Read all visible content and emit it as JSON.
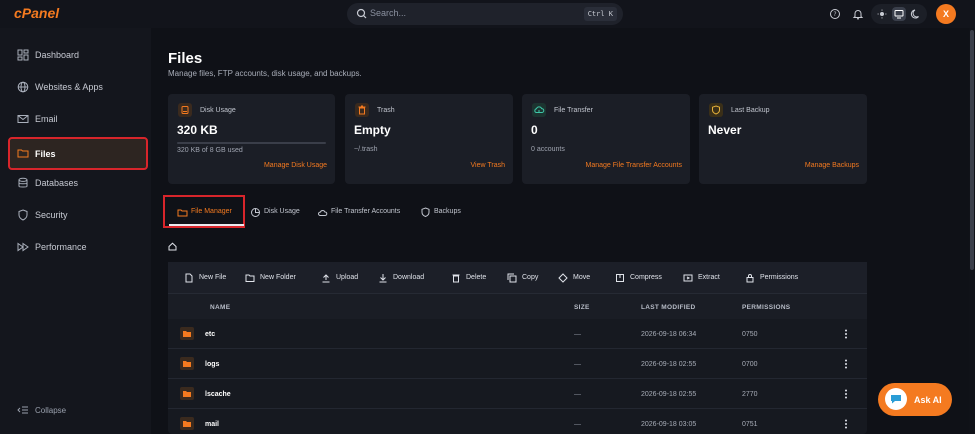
{
  "brand": {
    "logo": "cPanel",
    "accent": "#f47a20"
  },
  "search": {
    "placeholder": "Search...",
    "shortcut": "Ctrl K"
  },
  "user": {
    "initial": "X"
  },
  "sidebar": {
    "items": [
      {
        "label": "Dashboard",
        "icon": "dashboard-icon"
      },
      {
        "label": "Websites & Apps",
        "icon": "globe-icon"
      },
      {
        "label": "Email",
        "icon": "mail-icon"
      },
      {
        "label": "Files",
        "icon": "folder-icon",
        "active": true
      },
      {
        "label": "Databases",
        "icon": "database-icon"
      },
      {
        "label": "Security",
        "icon": "shield-icon"
      },
      {
        "label": "Performance",
        "icon": "fast-forward-icon"
      }
    ],
    "collapse_label": "Collapse"
  },
  "page": {
    "title": "Files",
    "subtitle": "Manage files, FTP accounts, disk usage, and backups."
  },
  "cards": [
    {
      "title": "Disk Usage",
      "value": "320 KB",
      "sub": "320 KB of 8 GB used",
      "link": "Manage Disk Usage",
      "icon": "disk-icon"
    },
    {
      "title": "Trash",
      "value": "Empty",
      "sub": "~/.trash",
      "link": "View Trash",
      "icon": "trash-icon"
    },
    {
      "title": "File Transfer",
      "value": "0",
      "sub": "0 accounts",
      "link": "Manage File Transfer Accounts",
      "icon": "cloud-upload-icon"
    },
    {
      "title": "Last Backup",
      "value": "Never",
      "sub": "",
      "link": "Manage Backups",
      "icon": "backup-icon"
    }
  ],
  "tabs": [
    {
      "label": "File Manager",
      "icon": "folder-icon",
      "active": true
    },
    {
      "label": "Disk Usage",
      "icon": "pie-chart-icon"
    },
    {
      "label": "File Transfer Accounts",
      "icon": "cloud-icon"
    },
    {
      "label": "Backups",
      "icon": "shield-icon"
    }
  ],
  "toolbar": {
    "new_file": "New File",
    "new_folder": "New Folder",
    "upload": "Upload",
    "download": "Download",
    "delete": "Delete",
    "copy": "Copy",
    "move": "Move",
    "compress": "Compress",
    "extract": "Extract",
    "permissions": "Permissions"
  },
  "table": {
    "columns": {
      "name": "NAME",
      "size": "SIZE",
      "modified": "LAST MODIFIED",
      "permissions": "PERMISSIONS"
    },
    "rows": [
      {
        "name": "etc",
        "size": "—",
        "modified": "2026-09-18 06:34",
        "permissions": "0750"
      },
      {
        "name": "logs",
        "size": "—",
        "modified": "2026-09-18 02:55",
        "permissions": "0700"
      },
      {
        "name": "lscache",
        "size": "—",
        "modified": "2026-09-18 02:55",
        "permissions": "2770"
      },
      {
        "name": "mail",
        "size": "—",
        "modified": "2026-09-18 03:05",
        "permissions": "0751"
      }
    ]
  },
  "ask_ai": {
    "label": "Ask AI"
  },
  "disk_usage_fraction": 4e-05
}
